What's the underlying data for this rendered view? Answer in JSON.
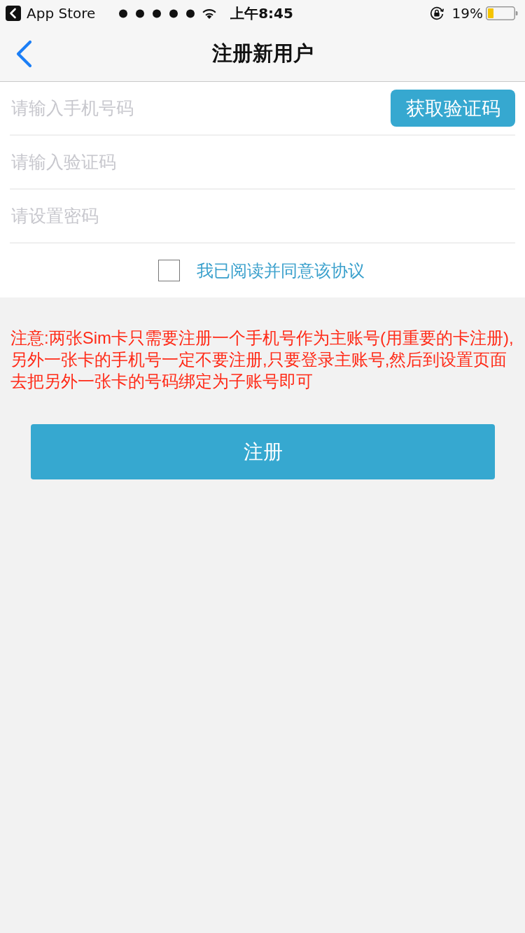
{
  "status_bar": {
    "back_app": "App Store",
    "time": "上午8:45",
    "battery": "19%"
  },
  "nav_bar": {
    "title": "注册新用户"
  },
  "form": {
    "fields": [
      {
        "placeholder": "请输入手机号码",
        "button": "获取验证码"
      },
      {
        "placeholder": "请输入验证码"
      },
      {
        "placeholder": "请设置密码"
      }
    ],
    "agreement": {
      "label": "我已阅读并同意该协议",
      "checked": false
    }
  },
  "notice": "注意:两张Sim卡只需要注册一个手机号作为主账号(用重要的卡注册),另外一张卡的手机号一定不要注册,只要登录主账号,然后到设置页面去把另外一张卡的号码绑定为子账号即可",
  "register_button": "注册"
}
